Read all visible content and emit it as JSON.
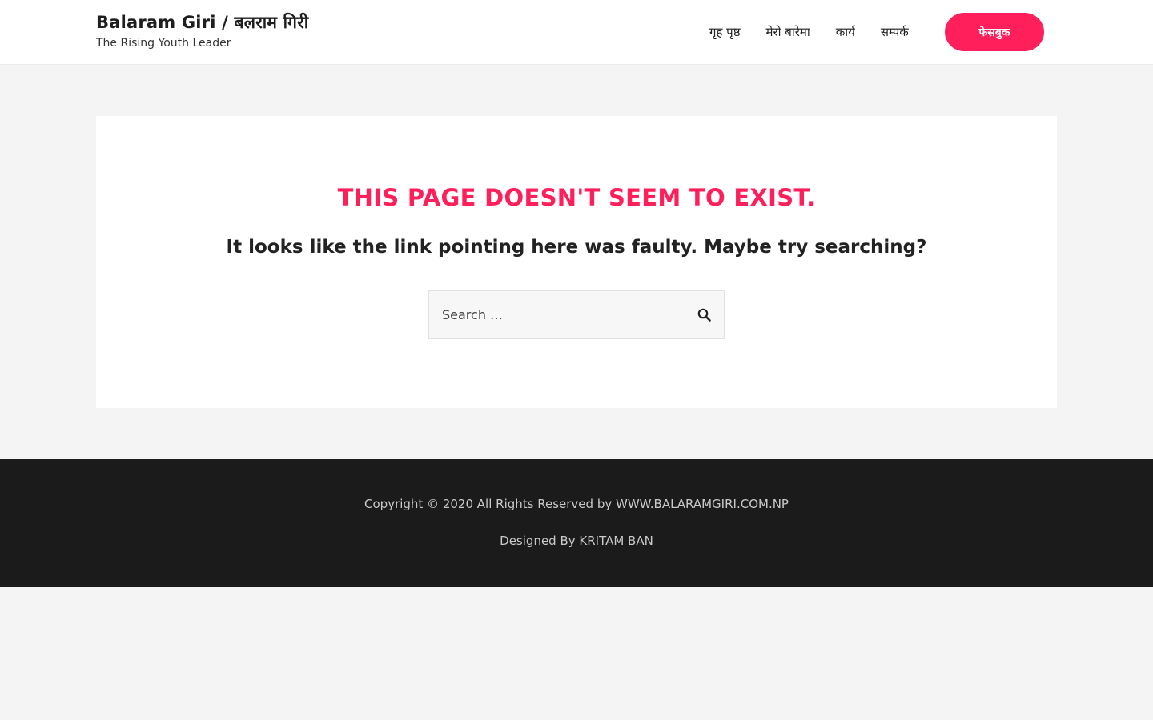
{
  "header": {
    "site_title": "Balaram Giri / बलराम गिरी",
    "tagline": "The Rising Youth Leader",
    "nav": [
      {
        "label": "गृह पृष्ठ"
      },
      {
        "label": "मेरो बारेमा"
      },
      {
        "label": "कार्य"
      },
      {
        "label": "सम्पर्क"
      }
    ],
    "cta_label": "फेसबुक"
  },
  "main": {
    "title": "This page doesn't seem to exist.",
    "subtitle": "It looks like the link pointing here was faulty. Maybe try searching?",
    "search": {
      "placeholder": "Search …",
      "value": "",
      "icon": "search-icon"
    }
  },
  "footer": {
    "copyright": "Copyright © 2020 All Rights Reserved by WWW.BALARAMGIRI.COM.NP",
    "designed_by": "Designed By KRITAM BAN"
  },
  "colors": {
    "accent": "#ff1f5a",
    "footer_bg": "#1b1b1b",
    "page_bg": "#f4f4f4"
  }
}
